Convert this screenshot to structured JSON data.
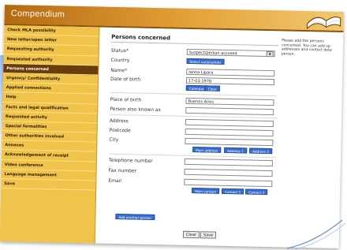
{
  "app": {
    "title": "Compendium"
  },
  "sidebar": {
    "items": [
      {
        "label": "Check MLA possibility"
      },
      {
        "label": "New letter/open letter"
      },
      {
        "label": "Requesting authority"
      },
      {
        "label": "Requested authority"
      },
      {
        "label": "Persons concerned",
        "active": true
      },
      {
        "label": "Urgency/ Confidentiality"
      },
      {
        "label": "Applied connections"
      },
      {
        "label": "Help"
      },
      {
        "label": "Facts and legal qualification"
      },
      {
        "label": "Requested activity"
      },
      {
        "label": "Special formalities"
      },
      {
        "label": "Other authorities involved"
      },
      {
        "label": "Annexes"
      },
      {
        "label": "Acknowledgement of receipt"
      },
      {
        "label": "Video conference"
      },
      {
        "label": "Language management"
      },
      {
        "label": "Save"
      }
    ]
  },
  "form": {
    "heading": "Persons concerned",
    "status": {
      "label": "Status*",
      "value": "Suspect/person accused"
    },
    "country": {
      "label": "Country",
      "button": "Select nationalities"
    },
    "name": {
      "label": "Name*",
      "value": "Ianna Lipara"
    },
    "dob": {
      "label": "Date of birth",
      "value": "17-03-1978",
      "calendar_button": "Calendar",
      "clear_button": "Clear"
    },
    "pob": {
      "label": "Place of birth",
      "value": "Buenos Aires"
    },
    "aka": {
      "label": "Person also known as",
      "value": ""
    },
    "address": {
      "label": "Address",
      "value": ""
    },
    "postcode": {
      "label": "Postcode",
      "value": ""
    },
    "city": {
      "label": "City",
      "value": ""
    },
    "address_buttons": [
      "Main address",
      "Address 1",
      "Address 2"
    ],
    "telephone": {
      "label": "Telephone number",
      "value": ""
    },
    "fax": {
      "label": "Fax number",
      "value": ""
    },
    "email": {
      "label": "Email",
      "value": ""
    },
    "contact_buttons": [
      "Main contact",
      "Contact 1",
      "Contact 2"
    ],
    "add_person_button": "Add another person",
    "clear_button": "Clear",
    "save_button": "Save"
  },
  "help": {
    "text": "Please add the persons concerned. You can add up addresses and contact deta person."
  },
  "colors": {
    "header": "#e4a23a",
    "sidebar": "#f0c44a",
    "active": "#6a3c0a",
    "button_blue": "#3a6fd0"
  }
}
